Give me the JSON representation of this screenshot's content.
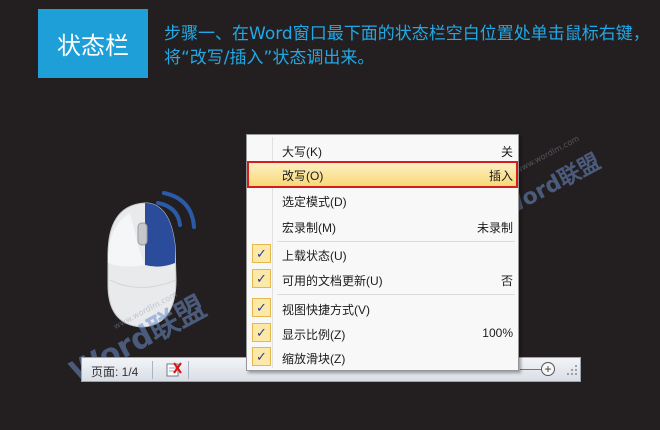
{
  "header": {
    "badge": "状态栏",
    "instruction": "步骤一、在Word窗口最下面的状态栏空白位置处单击鼠标右键，将“改写/插入”状态调出来。"
  },
  "watermark": {
    "word": "Word",
    "brand": "联盟",
    "small": "www.wordlm.com"
  },
  "statusbar": {
    "page_info": "页面: 1/4"
  },
  "context_menu": {
    "items": [
      {
        "label": "大写(K)",
        "value": "关",
        "checked": false
      },
      {
        "label": "改写(O)",
        "value": "插入",
        "checked": false,
        "highlighted": true
      },
      {
        "label": "选定模式(D)",
        "value": "",
        "checked": false
      },
      {
        "label": "宏录制(M)",
        "value": "未录制",
        "checked": false
      },
      {
        "label": "上载状态(U)",
        "value": "",
        "checked": true
      },
      {
        "label": "可用的文档更新(U)",
        "value": "否",
        "checked": true
      },
      {
        "label": "视图快捷方式(V)",
        "value": "",
        "checked": true
      },
      {
        "label": "显示比例(Z)",
        "value": "100%",
        "checked": true
      },
      {
        "label": "缩放滑块(Z)",
        "value": "",
        "checked": true
      }
    ]
  },
  "colors": {
    "accent": "#1e9fd8",
    "highlight_border": "#d41e1e",
    "background": "#231f20"
  }
}
